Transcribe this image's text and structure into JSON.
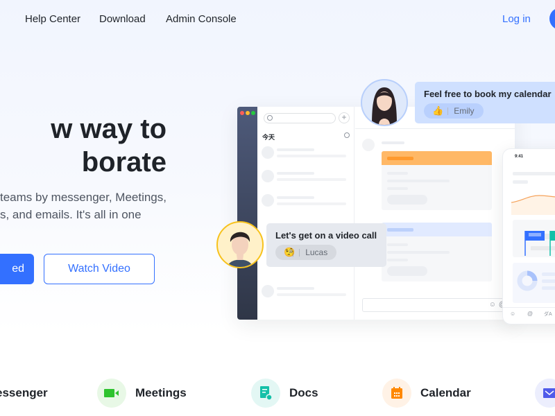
{
  "nav": {
    "links": [
      "Help Center",
      "Download",
      "Admin Console"
    ],
    "login": "Log in"
  },
  "hero": {
    "title_line1": "w way to",
    "title_line2": "borate",
    "subtitle_line1": "teams by messenger, Meetings,",
    "subtitle_line2": "s, and emails. It's all in one",
    "primary_button": "ed",
    "secondary_button": "Watch Video"
  },
  "mockup": {
    "list_section_label": "今天",
    "phone_time": "9:41",
    "emily_bubble": {
      "message": "Feel free to book my calendar",
      "reaction_icon": "thumbs-up-icon",
      "reaction_glyph": "👍",
      "name": "Emily"
    },
    "lucas_bubble": {
      "message": "Let's get on a video call",
      "reaction_icon": "thinking-face-icon",
      "reaction_glyph": "🧐",
      "name": "Lucas"
    },
    "composer_icons": [
      "emoji-icon",
      "mention-icon"
    ]
  },
  "features": [
    {
      "label": "essenger",
      "icon": "messenger-icon"
    },
    {
      "label": "Meetings",
      "icon": "video-camera-icon",
      "color": "#2ec32e"
    },
    {
      "label": "Docs",
      "icon": "docs-icon",
      "color": "#14c0a8"
    },
    {
      "label": "Calendar",
      "icon": "calendar-icon",
      "color": "#ff8800"
    },
    {
      "label": "",
      "icon": "mail-icon",
      "color": "#4f5bea"
    }
  ],
  "colors": {
    "accent": "#3370ff",
    "text": "#1f2329",
    "orange_card": "#ffb866",
    "blue_card": "#e1eaff",
    "emily_bubble": "#cfe0ff",
    "lucas_bubble": "#e6e9ef"
  }
}
